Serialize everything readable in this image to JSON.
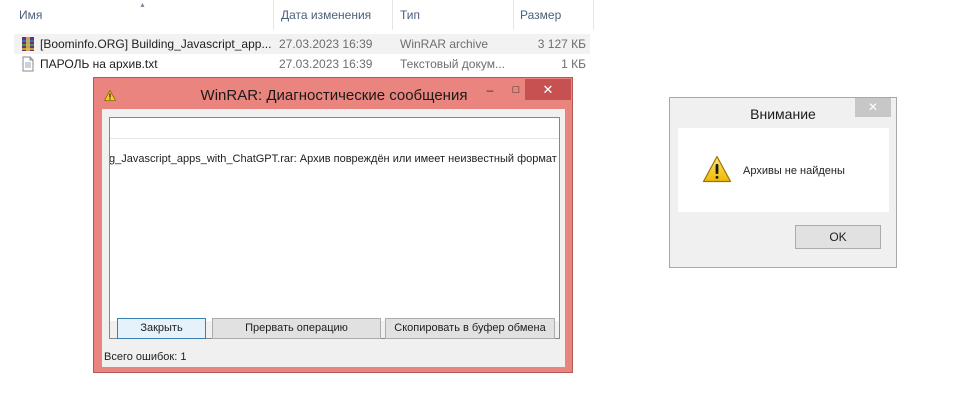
{
  "columns": {
    "name": "Имя",
    "date": "Дата изменения",
    "type": "Тип",
    "size": "Размер"
  },
  "files": [
    {
      "name": "[Boominfo.ORG] Building_Javascript_app...",
      "date": "27.03.2023 16:39",
      "type": "WinRAR archive",
      "size": "3 127 КБ",
      "icon": "winrar-archive-icon"
    },
    {
      "name": "ПАРОЛЬ на архив.txt",
      "date": "27.03.2023 16:39",
      "type": "Текстовый докум...",
      "size": "1 КБ",
      "icon": "text-file-icon"
    }
  ],
  "winrar_dialog": {
    "title": "WinRAR: Диагностические сообщения",
    "message": "g_Javascript_apps_with_ChatGPT.rar: Архив повреждён или имеет неизвестный формат",
    "buttons": {
      "close": "Закрыть",
      "abort": "Прервать операцию",
      "copy": "Скопировать в буфер обмена"
    },
    "status": "Всего ошибок: 1",
    "window_controls": {
      "minimize": "–",
      "maximize": "□",
      "close": "✕"
    },
    "colors": {
      "frame": "#e9847e",
      "close_button": "#c75050"
    }
  },
  "alert_dialog": {
    "title": "Внимание",
    "message": "Архивы не найдены",
    "ok": "OK",
    "close_glyph": "✕",
    "icon": "warning-icon"
  }
}
